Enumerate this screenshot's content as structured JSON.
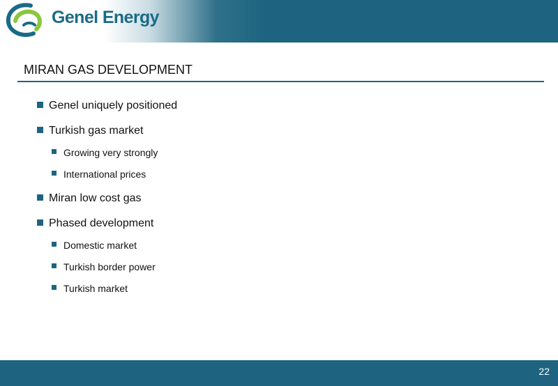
{
  "header": {
    "logo_text": "Genel Energy",
    "colors": {
      "band": "#1e6480",
      "logo_blue": "#1a6b86",
      "logo_green": "#8cc63f"
    }
  },
  "slide": {
    "title": "MIRAN GAS DEVELOPMENT",
    "bullets": [
      {
        "level": 1,
        "text": "Genel uniquely positioned"
      },
      {
        "level": 1,
        "text": "Turkish gas market"
      },
      {
        "level": 2,
        "text": "Growing very strongly"
      },
      {
        "level": 2,
        "text": "International prices"
      },
      {
        "level": 1,
        "text": "Miran low cost gas"
      },
      {
        "level": 1,
        "text": "Phased development"
      },
      {
        "level": 2,
        "text": "Domestic market"
      },
      {
        "level": 2,
        "text": "Turkish border power"
      },
      {
        "level": 2,
        "text": "Turkish market"
      }
    ]
  },
  "footer": {
    "page_number": "22"
  }
}
